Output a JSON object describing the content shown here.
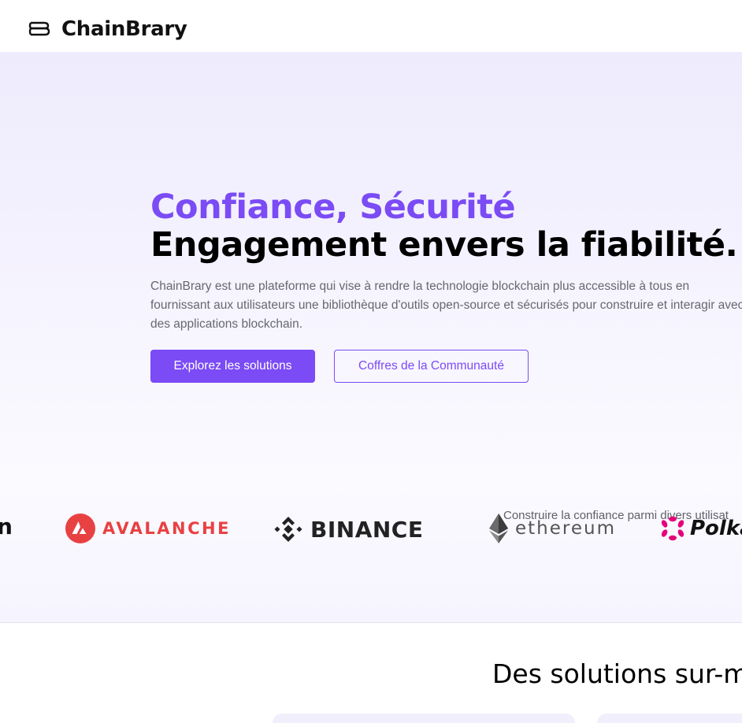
{
  "header": {
    "brand_name": "ChainBrary",
    "brand_icon": "stacked-books-icon"
  },
  "hero": {
    "title_line1": "Confiance, Sécurité",
    "title_line2": "Engagement envers la fiabilité.",
    "description": "ChainBrary est une plateforme qui vise à rendre la technologie blockchain plus accessible à tous en fournissant aux utilisateurs une bibliothèque d'outils open-source et sécurisés pour construire et interagir avec des applications blockchain.",
    "primary_button": "Explorez les solutions",
    "secondary_button": "Coffres de la Communauté",
    "trust_text": "Construire la confiance parmi divers utilisat"
  },
  "logos": {
    "partial": "n",
    "avalanche": "AVALANCHE",
    "binance": "BINANCE",
    "ethereum": "ethereum",
    "polkadot": "Polka"
  },
  "solutions": {
    "title": "Des solutions sur-m"
  },
  "colors": {
    "accent": "#7b4bf5",
    "avalanche": "#e84142",
    "polkadot": "#e6007a"
  }
}
